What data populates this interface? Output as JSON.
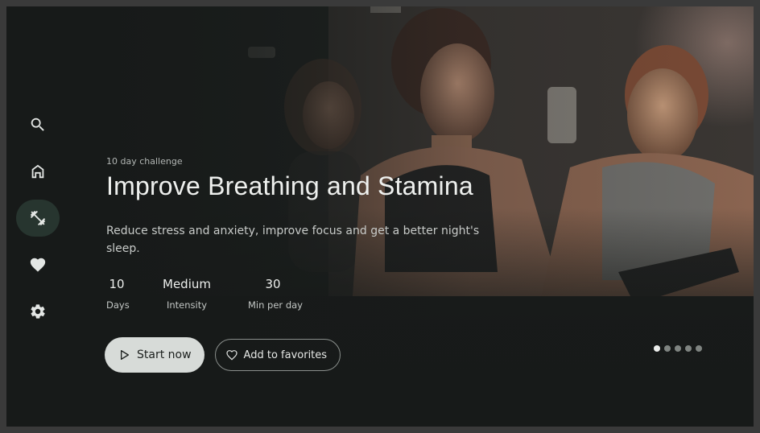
{
  "nav": {
    "items": [
      {
        "icon": "search-icon",
        "active": false
      },
      {
        "icon": "home-icon",
        "active": false
      },
      {
        "icon": "dumbbell-icon",
        "active": true
      },
      {
        "icon": "heart-icon",
        "active": false
      },
      {
        "icon": "gear-icon",
        "active": false
      }
    ]
  },
  "hero": {
    "eyebrow": "10 day challenge",
    "title": "Improve Breathing and Stamina",
    "description": "Reduce stress and anxiety, improve focus and get a better night's sleep.",
    "stats": [
      {
        "value": "10",
        "label": "Days"
      },
      {
        "value": "Medium",
        "label": "Intensity"
      },
      {
        "value": "30",
        "label": "Min per day"
      }
    ]
  },
  "actions": {
    "start_label": "Start now",
    "start_icon": "play-icon",
    "favorite_label": "Add to favorites",
    "favorite_icon": "heart-outline-icon"
  },
  "carousel": {
    "count": 5,
    "active_index": 0
  },
  "colors": {
    "background": "#171a19",
    "accent_active": "#27352f",
    "primary_button": "#d7dbd8"
  }
}
